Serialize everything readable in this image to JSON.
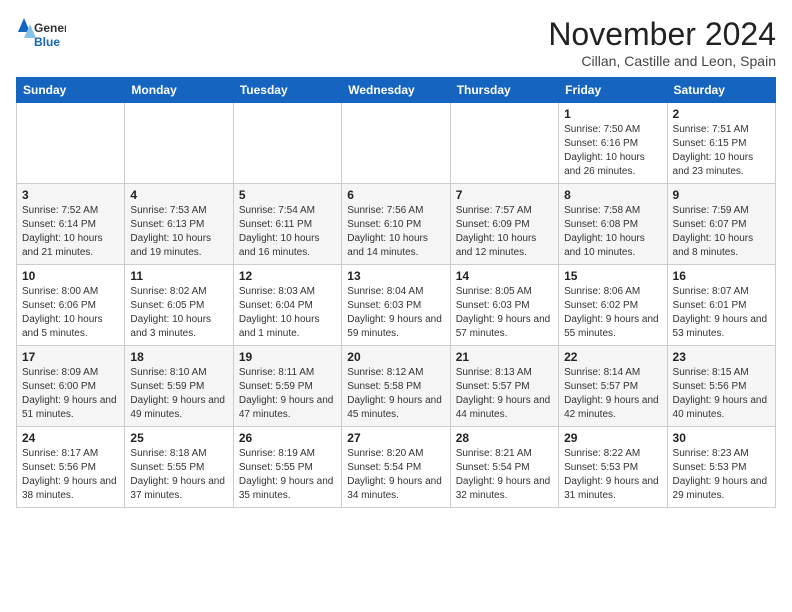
{
  "header": {
    "logo_general": "General",
    "logo_blue": "Blue",
    "month_title": "November 2024",
    "location": "Cillan, Castille and Leon, Spain"
  },
  "days_of_week": [
    "Sunday",
    "Monday",
    "Tuesday",
    "Wednesday",
    "Thursday",
    "Friday",
    "Saturday"
  ],
  "weeks": [
    [
      {
        "day": "",
        "info": ""
      },
      {
        "day": "",
        "info": ""
      },
      {
        "day": "",
        "info": ""
      },
      {
        "day": "",
        "info": ""
      },
      {
        "day": "",
        "info": ""
      },
      {
        "day": "1",
        "info": "Sunrise: 7:50 AM\nSunset: 6:16 PM\nDaylight: 10 hours and 26 minutes."
      },
      {
        "day": "2",
        "info": "Sunrise: 7:51 AM\nSunset: 6:15 PM\nDaylight: 10 hours and 23 minutes."
      }
    ],
    [
      {
        "day": "3",
        "info": "Sunrise: 7:52 AM\nSunset: 6:14 PM\nDaylight: 10 hours and 21 minutes."
      },
      {
        "day": "4",
        "info": "Sunrise: 7:53 AM\nSunset: 6:13 PM\nDaylight: 10 hours and 19 minutes."
      },
      {
        "day": "5",
        "info": "Sunrise: 7:54 AM\nSunset: 6:11 PM\nDaylight: 10 hours and 16 minutes."
      },
      {
        "day": "6",
        "info": "Sunrise: 7:56 AM\nSunset: 6:10 PM\nDaylight: 10 hours and 14 minutes."
      },
      {
        "day": "7",
        "info": "Sunrise: 7:57 AM\nSunset: 6:09 PM\nDaylight: 10 hours and 12 minutes."
      },
      {
        "day": "8",
        "info": "Sunrise: 7:58 AM\nSunset: 6:08 PM\nDaylight: 10 hours and 10 minutes."
      },
      {
        "day": "9",
        "info": "Sunrise: 7:59 AM\nSunset: 6:07 PM\nDaylight: 10 hours and 8 minutes."
      }
    ],
    [
      {
        "day": "10",
        "info": "Sunrise: 8:00 AM\nSunset: 6:06 PM\nDaylight: 10 hours and 5 minutes."
      },
      {
        "day": "11",
        "info": "Sunrise: 8:02 AM\nSunset: 6:05 PM\nDaylight: 10 hours and 3 minutes."
      },
      {
        "day": "12",
        "info": "Sunrise: 8:03 AM\nSunset: 6:04 PM\nDaylight: 10 hours and 1 minute."
      },
      {
        "day": "13",
        "info": "Sunrise: 8:04 AM\nSunset: 6:03 PM\nDaylight: 9 hours and 59 minutes."
      },
      {
        "day": "14",
        "info": "Sunrise: 8:05 AM\nSunset: 6:03 PM\nDaylight: 9 hours and 57 minutes."
      },
      {
        "day": "15",
        "info": "Sunrise: 8:06 AM\nSunset: 6:02 PM\nDaylight: 9 hours and 55 minutes."
      },
      {
        "day": "16",
        "info": "Sunrise: 8:07 AM\nSunset: 6:01 PM\nDaylight: 9 hours and 53 minutes."
      }
    ],
    [
      {
        "day": "17",
        "info": "Sunrise: 8:09 AM\nSunset: 6:00 PM\nDaylight: 9 hours and 51 minutes."
      },
      {
        "day": "18",
        "info": "Sunrise: 8:10 AM\nSunset: 5:59 PM\nDaylight: 9 hours and 49 minutes."
      },
      {
        "day": "19",
        "info": "Sunrise: 8:11 AM\nSunset: 5:59 PM\nDaylight: 9 hours and 47 minutes."
      },
      {
        "day": "20",
        "info": "Sunrise: 8:12 AM\nSunset: 5:58 PM\nDaylight: 9 hours and 45 minutes."
      },
      {
        "day": "21",
        "info": "Sunrise: 8:13 AM\nSunset: 5:57 PM\nDaylight: 9 hours and 44 minutes."
      },
      {
        "day": "22",
        "info": "Sunrise: 8:14 AM\nSunset: 5:57 PM\nDaylight: 9 hours and 42 minutes."
      },
      {
        "day": "23",
        "info": "Sunrise: 8:15 AM\nSunset: 5:56 PM\nDaylight: 9 hours and 40 minutes."
      }
    ],
    [
      {
        "day": "24",
        "info": "Sunrise: 8:17 AM\nSunset: 5:56 PM\nDaylight: 9 hours and 38 minutes."
      },
      {
        "day": "25",
        "info": "Sunrise: 8:18 AM\nSunset: 5:55 PM\nDaylight: 9 hours and 37 minutes."
      },
      {
        "day": "26",
        "info": "Sunrise: 8:19 AM\nSunset: 5:55 PM\nDaylight: 9 hours and 35 minutes."
      },
      {
        "day": "27",
        "info": "Sunrise: 8:20 AM\nSunset: 5:54 PM\nDaylight: 9 hours and 34 minutes."
      },
      {
        "day": "28",
        "info": "Sunrise: 8:21 AM\nSunset: 5:54 PM\nDaylight: 9 hours and 32 minutes."
      },
      {
        "day": "29",
        "info": "Sunrise: 8:22 AM\nSunset: 5:53 PM\nDaylight: 9 hours and 31 minutes."
      },
      {
        "day": "30",
        "info": "Sunrise: 8:23 AM\nSunset: 5:53 PM\nDaylight: 9 hours and 29 minutes."
      }
    ]
  ]
}
